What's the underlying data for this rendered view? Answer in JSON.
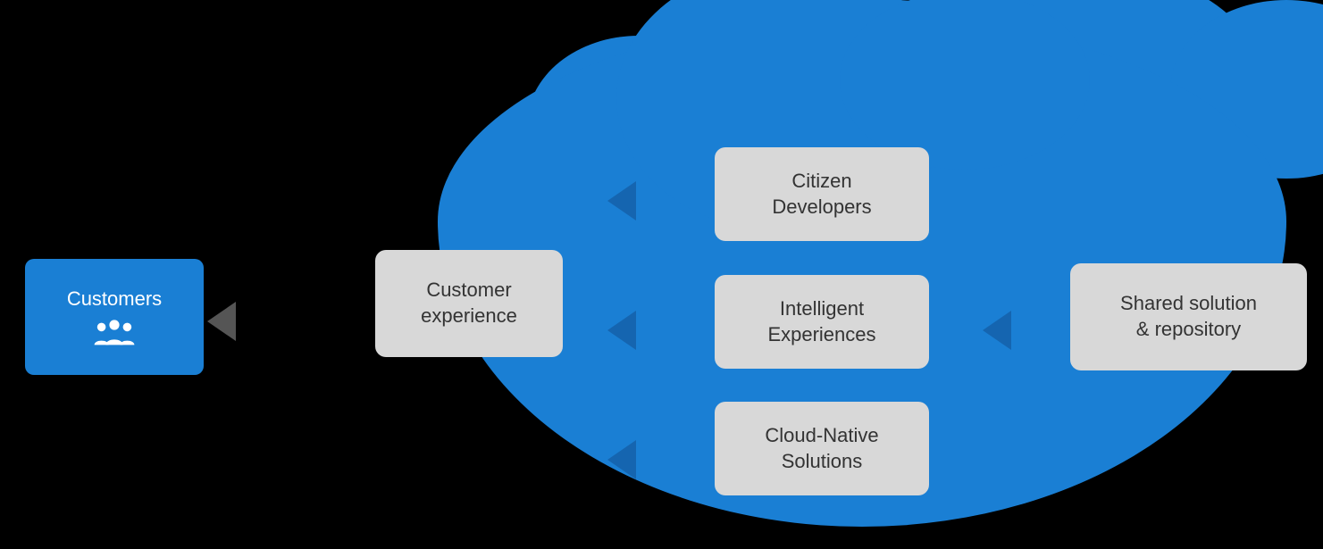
{
  "background": "#000000",
  "cloud": {
    "color": "#1a7fd4"
  },
  "customers": {
    "label": "Customers",
    "box_color": "#1a7fd4",
    "text_color": "#ffffff"
  },
  "customer_experience": {
    "label": "Customer\nexperience",
    "box_color": "#d8d8d8",
    "text_color": "#333333"
  },
  "inner_boxes": [
    {
      "id": "citizen-developers",
      "label": "Citizen\nDevelopers"
    },
    {
      "id": "intelligent-experiences",
      "label": "Intelligent\nExperiences"
    },
    {
      "id": "cloud-native-solutions",
      "label": "Cloud-Native\nSolutions"
    }
  ],
  "shared_repo": {
    "label": "Shared solution\n& repository",
    "box_color": "#d8d8d8",
    "text_color": "#333333"
  }
}
